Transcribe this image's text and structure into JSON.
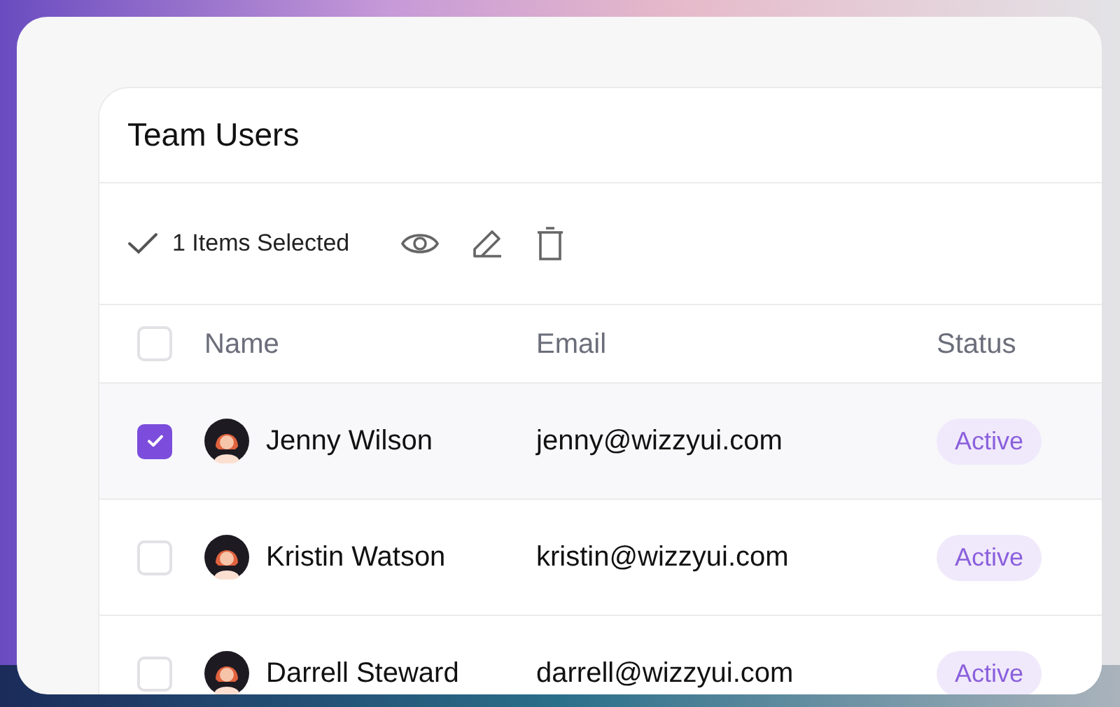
{
  "card": {
    "title": "Team Users"
  },
  "toolbar": {
    "selection_label": "1 Items Selected"
  },
  "table": {
    "columns": [
      "Name",
      "Email",
      "Status"
    ],
    "select_all": {
      "checked": false
    },
    "rows": [
      {
        "name": "Jenny Wilson",
        "email": "jenny@wizzyui.com",
        "status": "Active",
        "checked": true
      },
      {
        "name": "Kristin Watson",
        "email": "kristin@wizzyui.com",
        "status": "Active",
        "checked": false
      },
      {
        "name": "Darrell Steward",
        "email": "darrell@wizzyui.com",
        "status": "Active",
        "checked": false
      }
    ]
  }
}
